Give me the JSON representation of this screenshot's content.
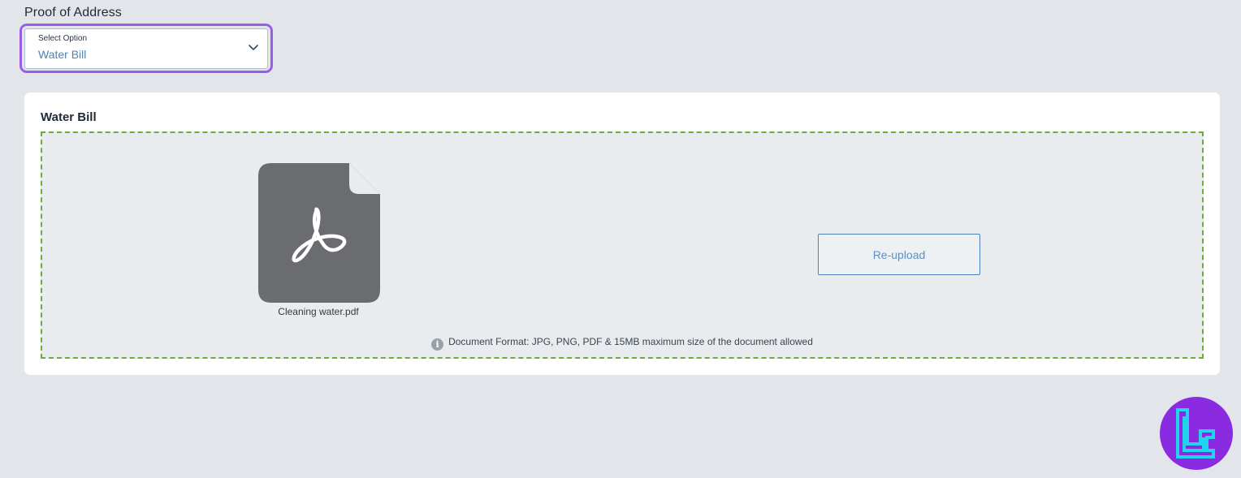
{
  "section": {
    "title": "Proof of Address"
  },
  "select": {
    "caption": "Select Option",
    "value": "Water Bill",
    "icon": "chevron-down-icon"
  },
  "upload_card": {
    "title": "Water Bill",
    "file": {
      "name": "Cleaning water.pdf",
      "icon": "pdf-file-icon"
    },
    "reupload_label": "Re-upload",
    "format_note": "Document Format: JPG, PNG, PDF & 15MB maximum size of the document allowed",
    "info_icon": "info-icon"
  },
  "colors": {
    "page_bg": "#e2e5e9",
    "select_highlight": "#9b5de5",
    "accent_blue": "#4f82b8",
    "dropzone_border": "#6aad3d",
    "file_icon": "#6b6c6f",
    "logo_bg": "#8a2be2",
    "logo_mark": "#22d3ee"
  }
}
